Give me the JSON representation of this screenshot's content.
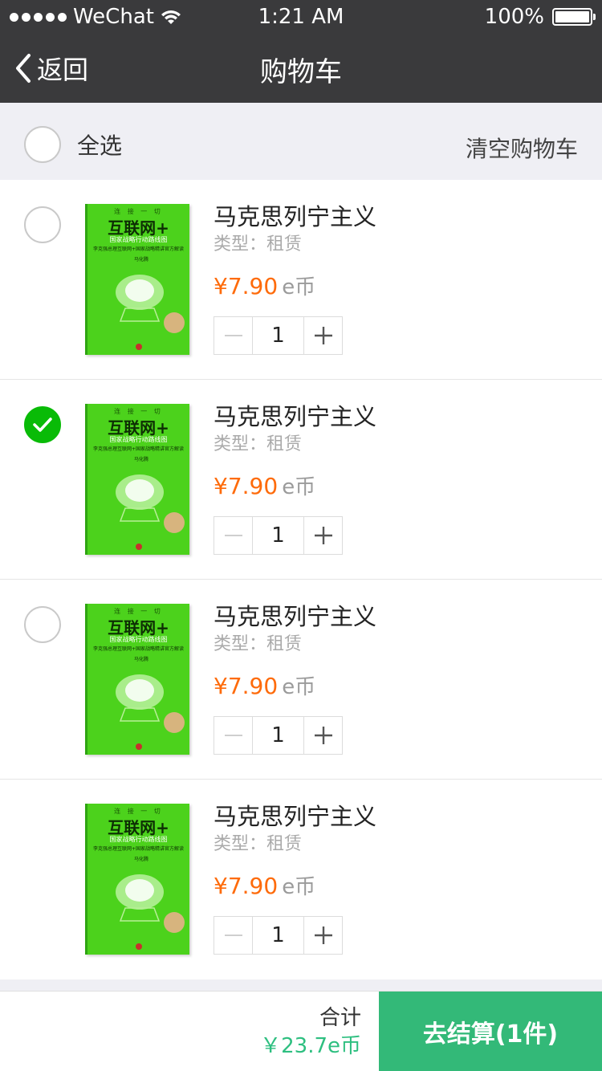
{
  "status_bar": {
    "carrier": "WeChat",
    "time": "1:21 AM",
    "battery": "100%"
  },
  "nav": {
    "back_label": "返回",
    "title": "购物车"
  },
  "select_bar": {
    "select_all_label": "全选",
    "clear_label": "清空购物车"
  },
  "cover": {
    "line1": "连 接 一 切",
    "line2": "互联网+",
    "line3": "国家战略行动路线图",
    "line4": "李克强总理互联网+国家战略精讲官方解读",
    "author": "马化腾"
  },
  "items": [
    {
      "name": "马克思列宁主义",
      "type": "类型：租赁",
      "price": "¥7.90",
      "unit": "e币",
      "qty": "1",
      "checked": false,
      "show_check": true
    },
    {
      "name": "马克思列宁主义",
      "type": "类型：租赁",
      "price": "¥7.90",
      "unit": "e币",
      "qty": "1",
      "checked": true,
      "show_check": true
    },
    {
      "name": "马克思列宁主义",
      "type": "类型：租赁",
      "price": "¥7.90",
      "unit": "e币",
      "qty": "1",
      "checked": false,
      "show_check": true
    },
    {
      "name": "马克思列宁主义",
      "type": "类型：租赁",
      "price": "¥7.90",
      "unit": "e币",
      "qty": "1",
      "checked": false,
      "show_check": false
    }
  ],
  "footer": {
    "total_label": "合计",
    "total_value": "￥23.7e币",
    "checkout_label": "去结算(1件)"
  },
  "colors": {
    "nav_bg": "#3a3a3c",
    "price": "#fe6b0b",
    "checked": "#09bb07",
    "checkout_bg": "#33b978",
    "total": "#2ebf80"
  }
}
